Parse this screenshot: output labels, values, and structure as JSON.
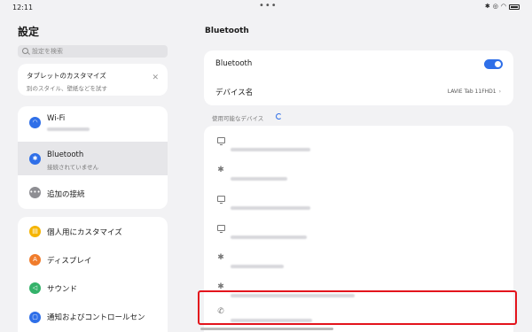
{
  "status": {
    "time": "12:11"
  },
  "left": {
    "title": "設定",
    "search_placeholder": "設定を検索",
    "promo": {
      "title": "タブレットのカスタマイズ",
      "subtitle": "別のスタイル、壁紙などを試す"
    },
    "network_items": [
      {
        "icon": "wifi-icon",
        "label": "Wi-Fi",
        "color": "#2f6fe8"
      },
      {
        "icon": "bluetooth-icon",
        "label": "Bluetooth",
        "sub": "接続されていません",
        "color": "#2f6fe8",
        "selected": true
      },
      {
        "icon": "more-connections-icon",
        "label": "追加の接続",
        "color": "#8e8e93"
      }
    ],
    "personal_items": [
      {
        "icon": "customize-icon",
        "label": "個人用にカスタマイズ",
        "color": "#f5b400"
      },
      {
        "icon": "display-icon",
        "label": "ディスプレイ",
        "color": "#f07c2c"
      },
      {
        "icon": "sound-icon",
        "label": "サウンド",
        "color": "#34b26a"
      },
      {
        "icon": "notification-icon",
        "label": "通知およびコントロールセン",
        "color": "#2f6fe8"
      }
    ]
  },
  "right": {
    "title": "Bluetooth",
    "bluetooth_label": "Bluetooth",
    "bluetooth_enabled": true,
    "device_name_label": "デバイス名",
    "device_name_value": "LAVIE Tab 11FHD1",
    "available_label": "使用可能なデバイス",
    "devices": [
      {
        "icon": "monitor-icon"
      },
      {
        "icon": "bluetooth-icon"
      },
      {
        "icon": "monitor-icon"
      },
      {
        "icon": "monitor-icon"
      },
      {
        "icon": "bluetooth-icon"
      },
      {
        "icon": "bluetooth-icon"
      },
      {
        "icon": "phone-icon"
      }
    ]
  },
  "colors": {
    "accent": "#2f6fe8",
    "highlight": "#e3141c"
  }
}
